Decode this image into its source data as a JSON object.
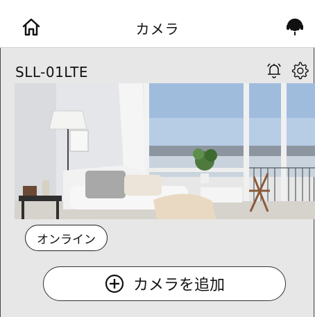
{
  "header": {
    "title": "カメラ",
    "home_icon": "home-icon",
    "support_icon": "headset-support-icon"
  },
  "device": {
    "name": "SLL-01LTE",
    "alarm_icon": "alarm-bell-icon",
    "settings_icon": "gear-icon",
    "status": "オンライン"
  },
  "actions": {
    "add_camera_label": "カメラを追加",
    "add_icon": "plus-circle-icon"
  },
  "colors": {
    "background": "#e7e7e7",
    "header_bg": "#ffffff",
    "button_bg": "#ffffff",
    "border": "#333333"
  }
}
